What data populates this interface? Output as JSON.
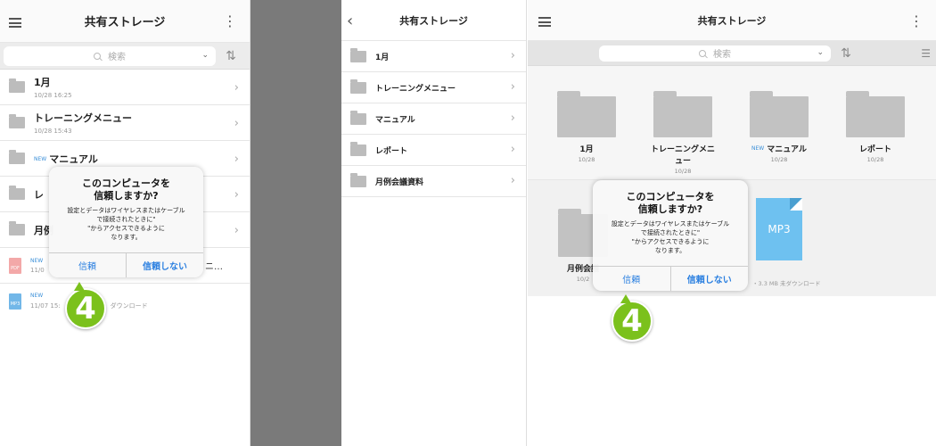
{
  "common": {
    "title": "共有ストレージ",
    "search_placeholder": "検索",
    "chevron": "›",
    "new_tag": "NEW"
  },
  "panel1": {
    "rows": [
      {
        "name": "1月",
        "date": "10/28 16:25"
      },
      {
        "name": "トレーニングメニュー",
        "date": "10/28 15:43"
      },
      {
        "name": "マニュアル",
        "date": ""
      },
      {
        "name": "レ",
        "date": ""
      },
      {
        "name": "月例",
        "date": ""
      },
      {
        "name": "ニ…",
        "date": "11/0"
      },
      {
        "name": "",
        "date": "11/07 15:",
        "status": "ダウンロード"
      }
    ],
    "pdf_label": "PDF",
    "mp3_label": "MP3"
  },
  "panel2": {
    "rows": [
      "1月",
      "トレーニングメニュー",
      "マニュアル",
      "レポート",
      "月例会議資料"
    ]
  },
  "panel3": {
    "folders": [
      {
        "name": "1月",
        "date": "10/28"
      },
      {
        "name": "トレーニングメニュー",
        "date": "10/28"
      },
      {
        "name": "マニュアル",
        "date": "10/28"
      },
      {
        "name": "レポート",
        "date": "10/28"
      }
    ],
    "folder5": {
      "name": "月例会議",
      "date": "10/2"
    },
    "mp3_label": "MP3",
    "mp3_meta": "・3.3 MB  未ダウンロード"
  },
  "dialog": {
    "title_line1": "このコンピュータを",
    "title_line2": "信頼しますか?",
    "body_line1": "設定とデータはワイヤレスまたはケーブル",
    "body_line2": "で接続されたときに\"",
    "body_line3": "\"からアクセスできるように",
    "body_line4": "なります。",
    "trust_button": "信頼",
    "dont_trust_button": "信頼しない"
  },
  "step_badge": "4",
  "colors": {
    "accent_blue": "#2a7fe0",
    "badge_green": "#7bc11c",
    "divider_gray": "#7a7a7a"
  }
}
